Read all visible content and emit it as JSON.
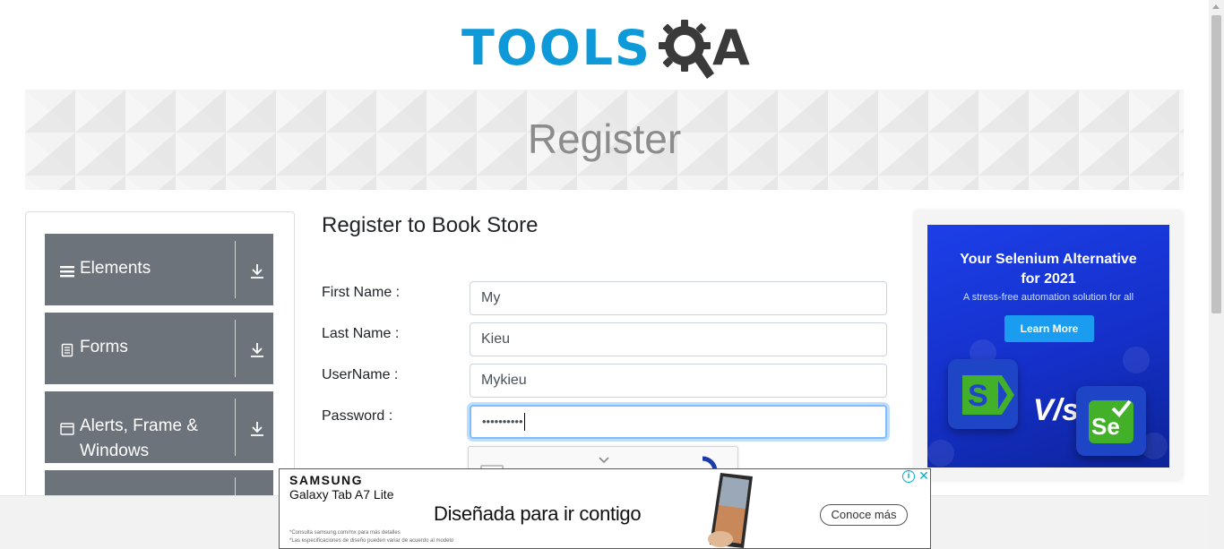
{
  "logo": {
    "text_left": "TOOLS",
    "text_right": "A",
    "icon": "gear-magnifier-icon",
    "colors": {
      "blue": "#0e9ad8",
      "dark": "#3a3a3a"
    }
  },
  "banner": {
    "title": "Register"
  },
  "sidebar": {
    "groups": [
      {
        "label": "Elements",
        "icon": "hamburger-icon"
      },
      {
        "label": "Forms",
        "icon": "document-icon"
      },
      {
        "label_line1": "Alerts, Frame &",
        "label_line2": "Windows",
        "icon": "window-icon"
      },
      {
        "label": "",
        "icon": ""
      }
    ],
    "toggle_icon": "download-arrow-icon",
    "group_color": "#6c737b"
  },
  "form": {
    "title": "Register to Book Store",
    "first_name": {
      "label": "First Name :",
      "value": "My"
    },
    "last_name": {
      "label": "Last Name :",
      "value": "Kieu"
    },
    "username": {
      "label": "UserName :",
      "value": "Mykieu"
    },
    "password": {
      "label": "Password :",
      "masked_value": "••••••••••",
      "focused": true
    },
    "captcha": {
      "icon": "recaptcha-icon"
    }
  },
  "right_ad": {
    "headline_line1": "Your Selenium Alternative",
    "headline_line2": "for 2021",
    "subline": "A stress-free automation solution for all",
    "button": "Learn More",
    "vs_text": "V/s",
    "logo_left": "S",
    "logo_right": "Se",
    "colors": {
      "bg": "#1c3fe8",
      "button": "#1a9cf0",
      "green": "#43b02a"
    }
  },
  "bottom_ad": {
    "brand": "SAMSUNG",
    "model": "Galaxy Tab A7 Lite",
    "tagline": "Diseñada para ir contigo",
    "fine_print_1": "*Consulta samsung.com/mx para más detalles",
    "fine_print_2": "*Las especificaciones de diseño pueden variar de acuerdo al modelo",
    "cta": "Conoce más",
    "info": "i",
    "close": "✕"
  }
}
